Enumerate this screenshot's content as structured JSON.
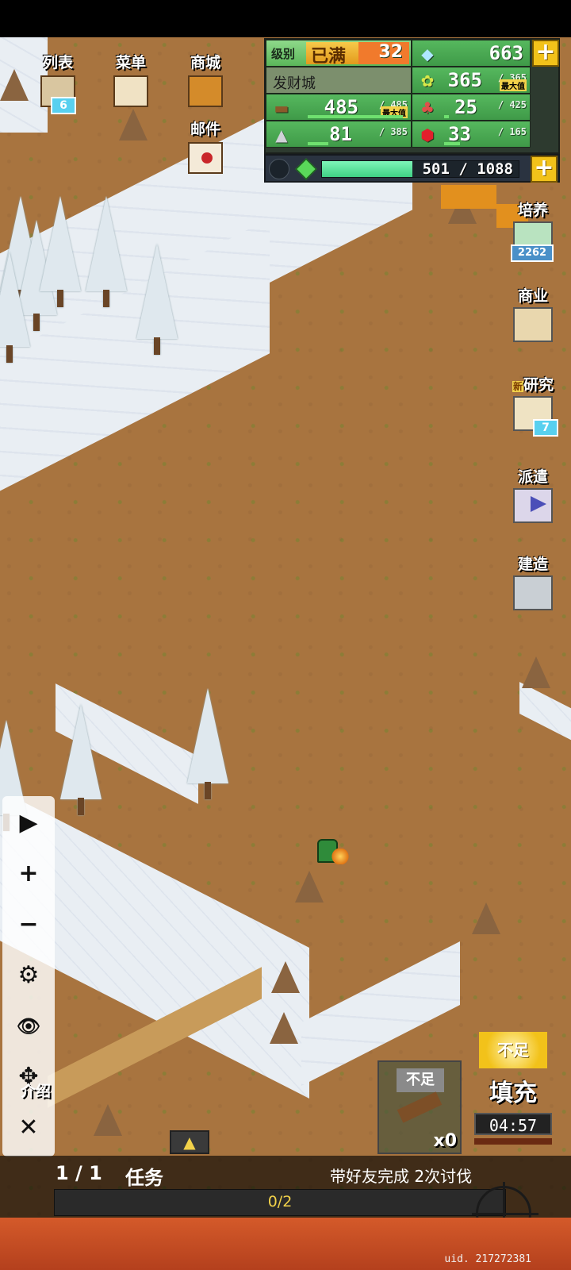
{
  "top_menu": {
    "list_label": "列表",
    "list_badge": "6",
    "menu_label": "菜单",
    "shop_label": "商城",
    "mail_label": "邮件"
  },
  "resources": {
    "level_label": "级别",
    "level_status": "已满",
    "level_value": "32",
    "gems": "663",
    "town_name": "发财城",
    "grain_value": "365",
    "grain_max": "/ 365",
    "wood_value": "485",
    "wood_max": "/ 485",
    "max_tag": "最大值",
    "food_value": "25",
    "food_max": "/ 425",
    "ore_value": "81",
    "ore_max": "/ 385",
    "ruby_value": "33",
    "ruby_max": "/ 165",
    "energy_value": "501",
    "energy_max": "/ 1088",
    "energy_fill": 0.46,
    "grain_fill": 1.0,
    "wood_fill": 1.0,
    "food_fill": 0.06,
    "ore_fill": 0.21,
    "ruby_fill": 0.2
  },
  "side_menu": {
    "train_label": "培养",
    "train_badge": "2262",
    "business_label": "商业",
    "research_new": "新",
    "research_label": "研究",
    "research_badge": "7",
    "dispatch_label": "派遣",
    "build_label": "建造"
  },
  "controls": {
    "play": "▶",
    "zoom_in": "+",
    "zoom_out": "−",
    "settings": "⚙",
    "hide": "👁",
    "move": "✥",
    "close": "✕"
  },
  "intro_label": "介绍",
  "build_card": {
    "tag": "不足",
    "count": "x0"
  },
  "fill_card": {
    "tag": "不足",
    "label": "填充",
    "timer": "04:57"
  },
  "task": {
    "counter": "1 / 1",
    "label": "任务",
    "description": "带好友完成 2次讨伐",
    "progress_text": "0/2",
    "progress_fill": 0.0
  },
  "uid_text": "uid. 217272381",
  "colors": {
    "ground": "#a8743f",
    "snow": "#e9eef3",
    "panel_green": "#4aa852",
    "accent_yellow": "#f2c21a",
    "bottom_strip": "#c94d22"
  }
}
